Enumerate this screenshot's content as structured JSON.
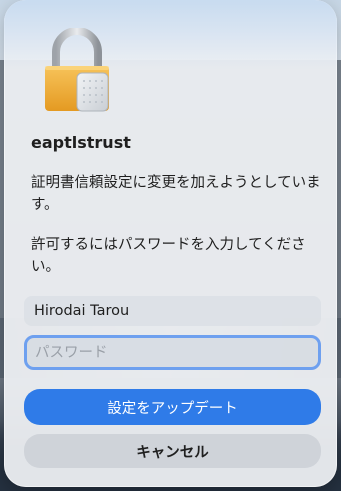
{
  "dialog": {
    "app_name": "eaptlstrust",
    "message": "証明書信頼設定に変更を加えようとしています。",
    "instruction": "許可するにはパスワードを入力してください。"
  },
  "form": {
    "username_value": "Hirodai Tarou",
    "password_placeholder": "パスワード",
    "password_value": ""
  },
  "buttons": {
    "primary_label": "設定をアップデート",
    "cancel_label": "キャンセル"
  },
  "colors": {
    "accent": "#2f7be8",
    "focus_ring": "#6ea0ef",
    "lock_gold": "#f2b13a"
  },
  "icons": {
    "app_icon": "lock-icon"
  }
}
